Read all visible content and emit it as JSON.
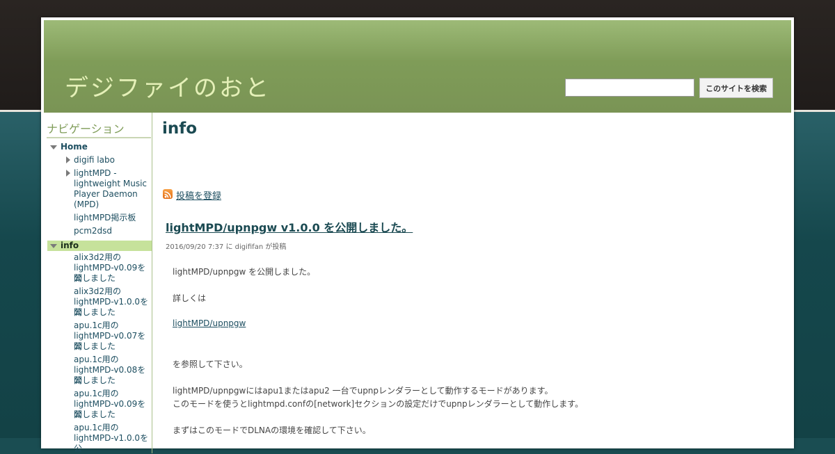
{
  "site": {
    "title": "デジファイのおと"
  },
  "search": {
    "placeholder": "",
    "button_label": "このサイトを検索"
  },
  "sidebar": {
    "heading": "ナビゲーション",
    "items": [
      {
        "label": "Home"
      },
      {
        "label": "digifi labo"
      },
      {
        "label": "lightMPD -"
      },
      {
        "label": "lightweight Music"
      },
      {
        "label": "Player Daemon"
      },
      {
        "label": "(MPD)"
      },
      {
        "label": "lightMPD掲示板"
      },
      {
        "label": "pcm2dsd"
      },
      {
        "label": "info"
      },
      {
        "label": "alix3d2用の"
      },
      {
        "label": "lightMPD-v0.09を公"
      },
      {
        "label": "開しました"
      },
      {
        "label": "alix3d2用の"
      },
      {
        "label": "lightMPD-v1.0.0を公"
      },
      {
        "label": "開しました"
      },
      {
        "label": "apu.1c用の"
      },
      {
        "label": "lightMPD-v0.07を公"
      },
      {
        "label": "開しました"
      },
      {
        "label": "apu.1c用の"
      },
      {
        "label": "lightMPD-v0.08を公"
      },
      {
        "label": "開しました"
      },
      {
        "label": "apu.1c用の"
      },
      {
        "label": "lightMPD-v0.09を公"
      },
      {
        "label": "開しました"
      },
      {
        "label": "apu.1c用の"
      },
      {
        "label": "lightMPD-v1.0.0を公"
      }
    ]
  },
  "main": {
    "page_title": "info",
    "subscribe_label": "投稿を登録",
    "post": {
      "title": "lightMPD/upnpgw v1.0.0 を公開しました。",
      "meta": "2016/09/20 7:37 に digififan が投稿",
      "lines": [
        "lightMPD/upnpgw を公開しました。",
        "詳しくは",
        "lightMPD/upnpgw",
        "を参照して下さい。",
        "lightMPD/upnpgwにはapu1またはapu2 一台でupnpレンダラーとして動作するモードがあります。",
        "このモードを使うとlightmpd.confの[network]セクションの設定だけでupnpレンダラーとして動作します。",
        "まずはこのモードでDLNAの環境を確認して下さい。"
      ]
    }
  },
  "colors": {
    "header_green": "#7f9c58",
    "title_text": "#e5f0b8",
    "link_blue": "#1d4e60",
    "selected_bg": "#c6e29b",
    "teal_background": "#1a4d52"
  }
}
